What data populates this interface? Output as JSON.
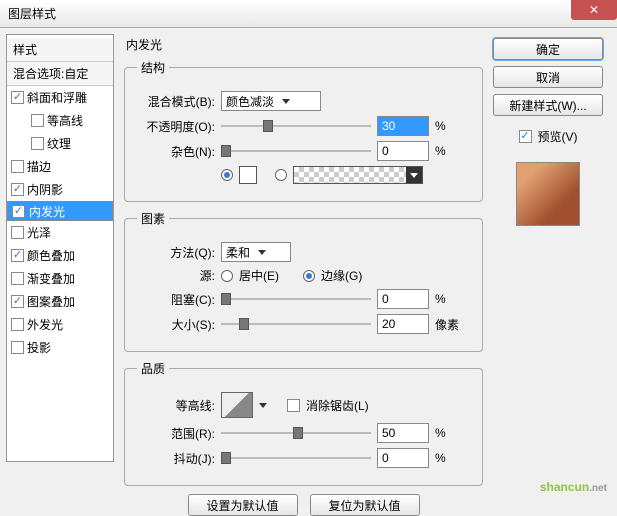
{
  "title": "图层样式",
  "styles": {
    "header": "样式",
    "blending": "混合选项:自定",
    "items": [
      {
        "label": "斜面和浮雕",
        "checked": true,
        "indent": false
      },
      {
        "label": "等高线",
        "checked": false,
        "indent": true
      },
      {
        "label": "纹理",
        "checked": false,
        "indent": true
      },
      {
        "label": "描边",
        "checked": false,
        "indent": false
      },
      {
        "label": "内阴影",
        "checked": true,
        "indent": false
      },
      {
        "label": "内发光",
        "checked": true,
        "indent": false,
        "selected": true
      },
      {
        "label": "光泽",
        "checked": false,
        "indent": false
      },
      {
        "label": "颜色叠加",
        "checked": true,
        "indent": false
      },
      {
        "label": "渐变叠加",
        "checked": false,
        "indent": false
      },
      {
        "label": "图案叠加",
        "checked": true,
        "indent": false
      },
      {
        "label": "外发光",
        "checked": false,
        "indent": false
      },
      {
        "label": "投影",
        "checked": false,
        "indent": false
      }
    ]
  },
  "panel": {
    "title": "内发光",
    "structure": {
      "legend": "结构",
      "blend_label": "混合模式(B):",
      "blend_value": "颜色减淡",
      "opacity_label": "不透明度(O):",
      "opacity_value": "30",
      "opacity_unit": "%",
      "noise_label": "杂色(N):",
      "noise_value": "0",
      "noise_unit": "%"
    },
    "elements": {
      "legend": "图素",
      "technique_label": "方法(Q):",
      "technique_value": "柔和",
      "source_label": "源:",
      "source_center": "居中(E)",
      "source_edge": "边缘(G)",
      "choke_label": "阻塞(C):",
      "choke_value": "0",
      "choke_unit": "%",
      "size_label": "大小(S):",
      "size_value": "20",
      "size_unit": "像素"
    },
    "quality": {
      "legend": "品质",
      "contour_label": "等高线:",
      "antialias": "消除锯齿(L)",
      "range_label": "范围(R):",
      "range_value": "50",
      "range_unit": "%",
      "jitter_label": "抖动(J):",
      "jitter_value": "0",
      "jitter_unit": "%"
    },
    "set_default": "设置为默认值",
    "reset_default": "复位为默认值"
  },
  "right": {
    "ok": "确定",
    "cancel": "取消",
    "new_style": "新建样式(W)...",
    "preview": "预览(V)"
  },
  "watermark": "shancun"
}
